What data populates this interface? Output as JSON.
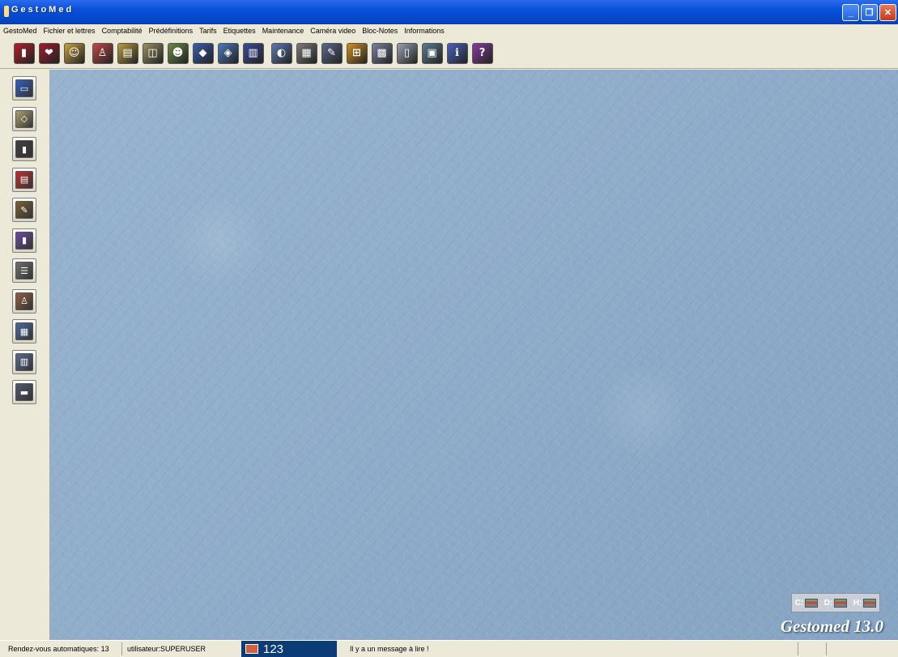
{
  "window": {
    "title": "GestoMed",
    "buttons": [
      "minimize",
      "maximize",
      "close"
    ]
  },
  "menu": [
    "GestoMed",
    "Fichier et lettres",
    "Comptabilité",
    "Prédéfinitions",
    "Tarifs",
    "Etiquettes",
    "Maintenance",
    "Caméra video",
    "Bloc-Notes",
    "Informations"
  ],
  "toolbar": [
    {
      "icon": "exit-door-icon",
      "color": "#b3202a"
    },
    {
      "icon": "patient-book-icon",
      "color": "#a01830"
    },
    {
      "icon": "people-group-icon",
      "color": "#c7a040"
    },
    {
      "icon": "person-icon",
      "color": "#c04848"
    },
    {
      "icon": "calendar-notes-icon",
      "color": "#b89a40"
    },
    {
      "icon": "open-book-icon",
      "color": "#9a9060"
    },
    {
      "icon": "couple-icon",
      "color": "#6a8a40"
    },
    {
      "icon": "blue-book-icon",
      "color": "#3a5ab0"
    },
    {
      "icon": "books-stack-icon",
      "color": "#4a78c0"
    },
    {
      "icon": "binder-icon",
      "color": "#3a4a9a"
    },
    {
      "icon": "scanner-icon",
      "color": "#5a7ab0"
    },
    {
      "icon": "keyboard-icon",
      "color": "#7a7a7a"
    },
    {
      "icon": "pen-icon",
      "color": "#5a6a8a"
    },
    {
      "icon": "network-icon",
      "color": "#d09020"
    },
    {
      "icon": "calculator-icon",
      "color": "#7a80a0"
    },
    {
      "icon": "document-icon",
      "color": "#9aa0b0"
    },
    {
      "icon": "printer-icon",
      "color": "#5a7a90"
    },
    {
      "icon": "info-icon",
      "color": "#4a60c0"
    },
    {
      "icon": "help-book-icon",
      "color": "#8a3aa0"
    }
  ],
  "sidebar": [
    {
      "icon": "monitor-icon",
      "color": "#3060c0"
    },
    {
      "icon": "disk-drive-icon",
      "color": "#b0a070"
    },
    {
      "icon": "door-red-icon",
      "color": "#404040"
    },
    {
      "icon": "calendar-planner-icon",
      "color": "#c03030"
    },
    {
      "icon": "pencil-book-icon",
      "color": "#7a6030"
    },
    {
      "icon": "stats-chart-icon",
      "color": "#6a4aa0"
    },
    {
      "icon": "list-grid-icon",
      "color": "#707070"
    },
    {
      "icon": "person-outline-icon",
      "color": "#906040"
    },
    {
      "icon": "agenda-grid-icon",
      "color": "#4a6aa0"
    },
    {
      "icon": "building-icon",
      "color": "#5a6a90"
    },
    {
      "icon": "terminal-icon",
      "color": "#505a70"
    }
  ],
  "drives": [
    "C:",
    "D:",
    "H:"
  ],
  "brand": "Gestomed  13.0",
  "status": {
    "appointments": "Rendez-vous automatiques: 13",
    "user": "utilisateur:SUPERUSER",
    "count": "123",
    "message": "Il y a un message à lire !"
  }
}
